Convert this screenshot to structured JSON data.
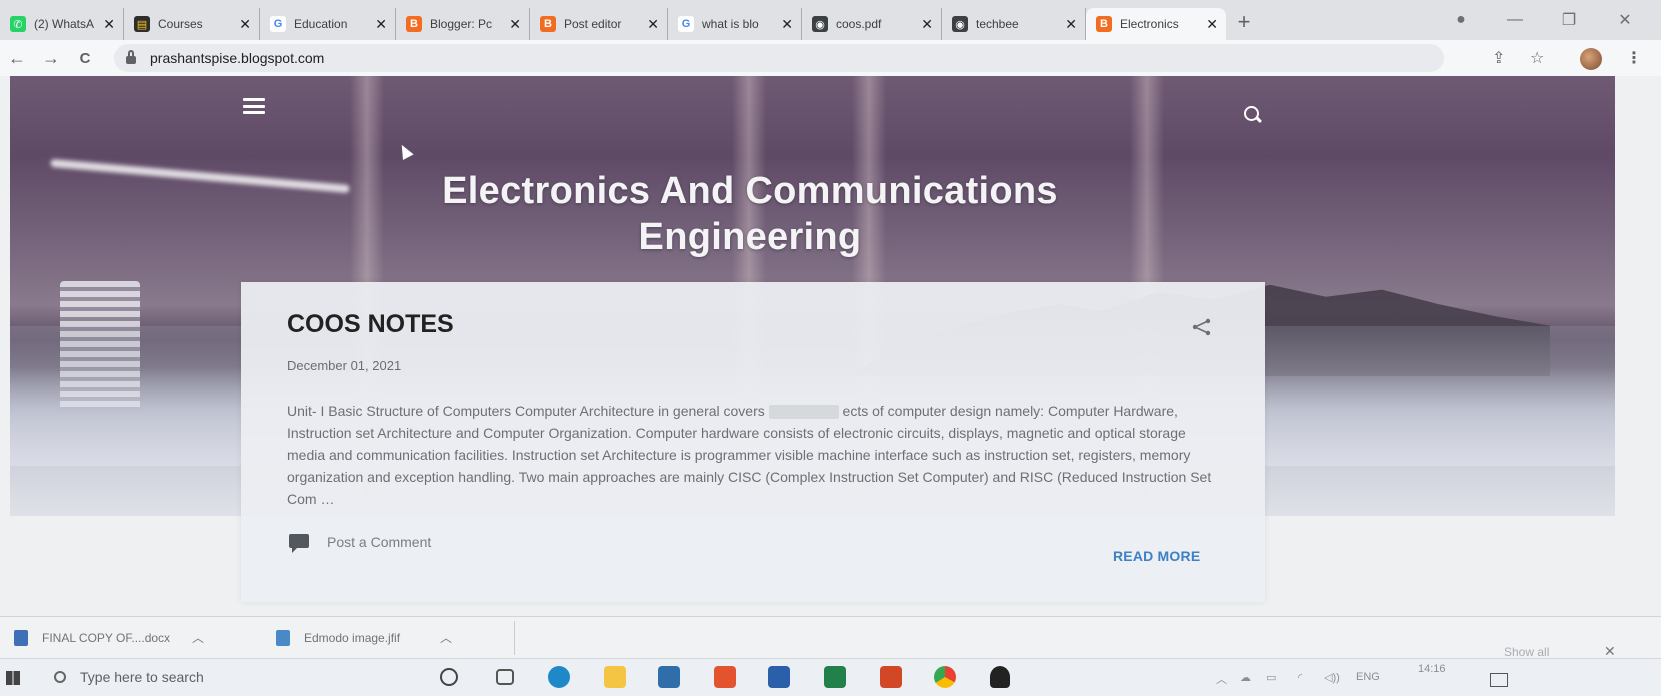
{
  "browser": {
    "tabs": [
      {
        "label": "(2) WhatsA",
        "favicon_color": "#25d366",
        "favicon_glyph": "✆",
        "active": false
      },
      {
        "label": "Courses",
        "favicon_color": "#2d2d2d",
        "favicon_glyph": "▤",
        "active": false
      },
      {
        "label": "Education",
        "favicon_color": "#ffffff",
        "favicon_glyph": "G",
        "active": false
      },
      {
        "label": "Blogger: Pc",
        "favicon_color": "#f26c21",
        "favicon_glyph": "B",
        "active": false
      },
      {
        "label": "Post editor",
        "favicon_color": "#f26c21",
        "favicon_glyph": "B",
        "active": false
      },
      {
        "label": "what is blo",
        "favicon_color": "#ffffff",
        "favicon_glyph": "G",
        "active": false
      },
      {
        "label": "coos.pdf",
        "favicon_color": "#3c4043",
        "favicon_glyph": "◉",
        "active": false
      },
      {
        "label": "techbee",
        "favicon_color": "#3c4043",
        "favicon_glyph": "◉",
        "active": false
      },
      {
        "label": "Electronics",
        "favicon_color": "#f26c21",
        "favicon_glyph": "B",
        "active": true
      }
    ],
    "new_tab_glyph": "+",
    "close_glyph": "✕",
    "url": "prashantspise.blogspot.com",
    "back_glyph": "←",
    "forward_glyph": "→",
    "reload_glyph": "C"
  },
  "blog": {
    "title": "Electronics And Communications Engineering",
    "post": {
      "title": "COOS NOTES",
      "date": "December 01, 2021",
      "snippet_part1": "Unit- I Basic Structure of Computers Computer Architecture in general covers",
      "snippet_part2": "ects of computer design namely: Computer Hardware, Instruction set Architecture and Computer Organization. Computer hardware consists of electronic circuits, displays, magnetic and optical storage media and communication facilities. Instruction set Architecture is programmer visible machine interface such as instruction set, registers, memory organization and exception handling. Two main approaches are mainly CISC (Complex Instruction Set Computer) and RISC (Reduced Instruction Set Com",
      "snippet_ellipsis": "…",
      "comment_label": "Post a Comment",
      "read_more_label": "READ MORE"
    }
  },
  "downloads": {
    "items": [
      {
        "label": "FINAL COPY OF....docx",
        "icon_color": "#3f6fb6"
      },
      {
        "label": "Edmodo image.jfif",
        "icon_color": "#4a89c8"
      }
    ],
    "show_all_label": "Show all"
  },
  "taskbar": {
    "search_placeholder": "Type here to search",
    "language": "ENG",
    "time": "14:16",
    "apps": [
      {
        "name": "cortana",
        "color": "#ffffff"
      },
      {
        "name": "task-view",
        "color": "#ffffff"
      },
      {
        "name": "edge",
        "color": "#1e88c8"
      },
      {
        "name": "file-explorer",
        "color": "#f4c542"
      },
      {
        "name": "mail",
        "color": "#2f6ea8"
      },
      {
        "name": "office",
        "color": "#e2532e"
      },
      {
        "name": "word",
        "color": "#2b5faa"
      },
      {
        "name": "excel",
        "color": "#22804a"
      },
      {
        "name": "powerpoint",
        "color": "#d24726"
      },
      {
        "name": "chrome",
        "color": "#e94235"
      },
      {
        "name": "teams",
        "color": "#222222"
      }
    ]
  }
}
